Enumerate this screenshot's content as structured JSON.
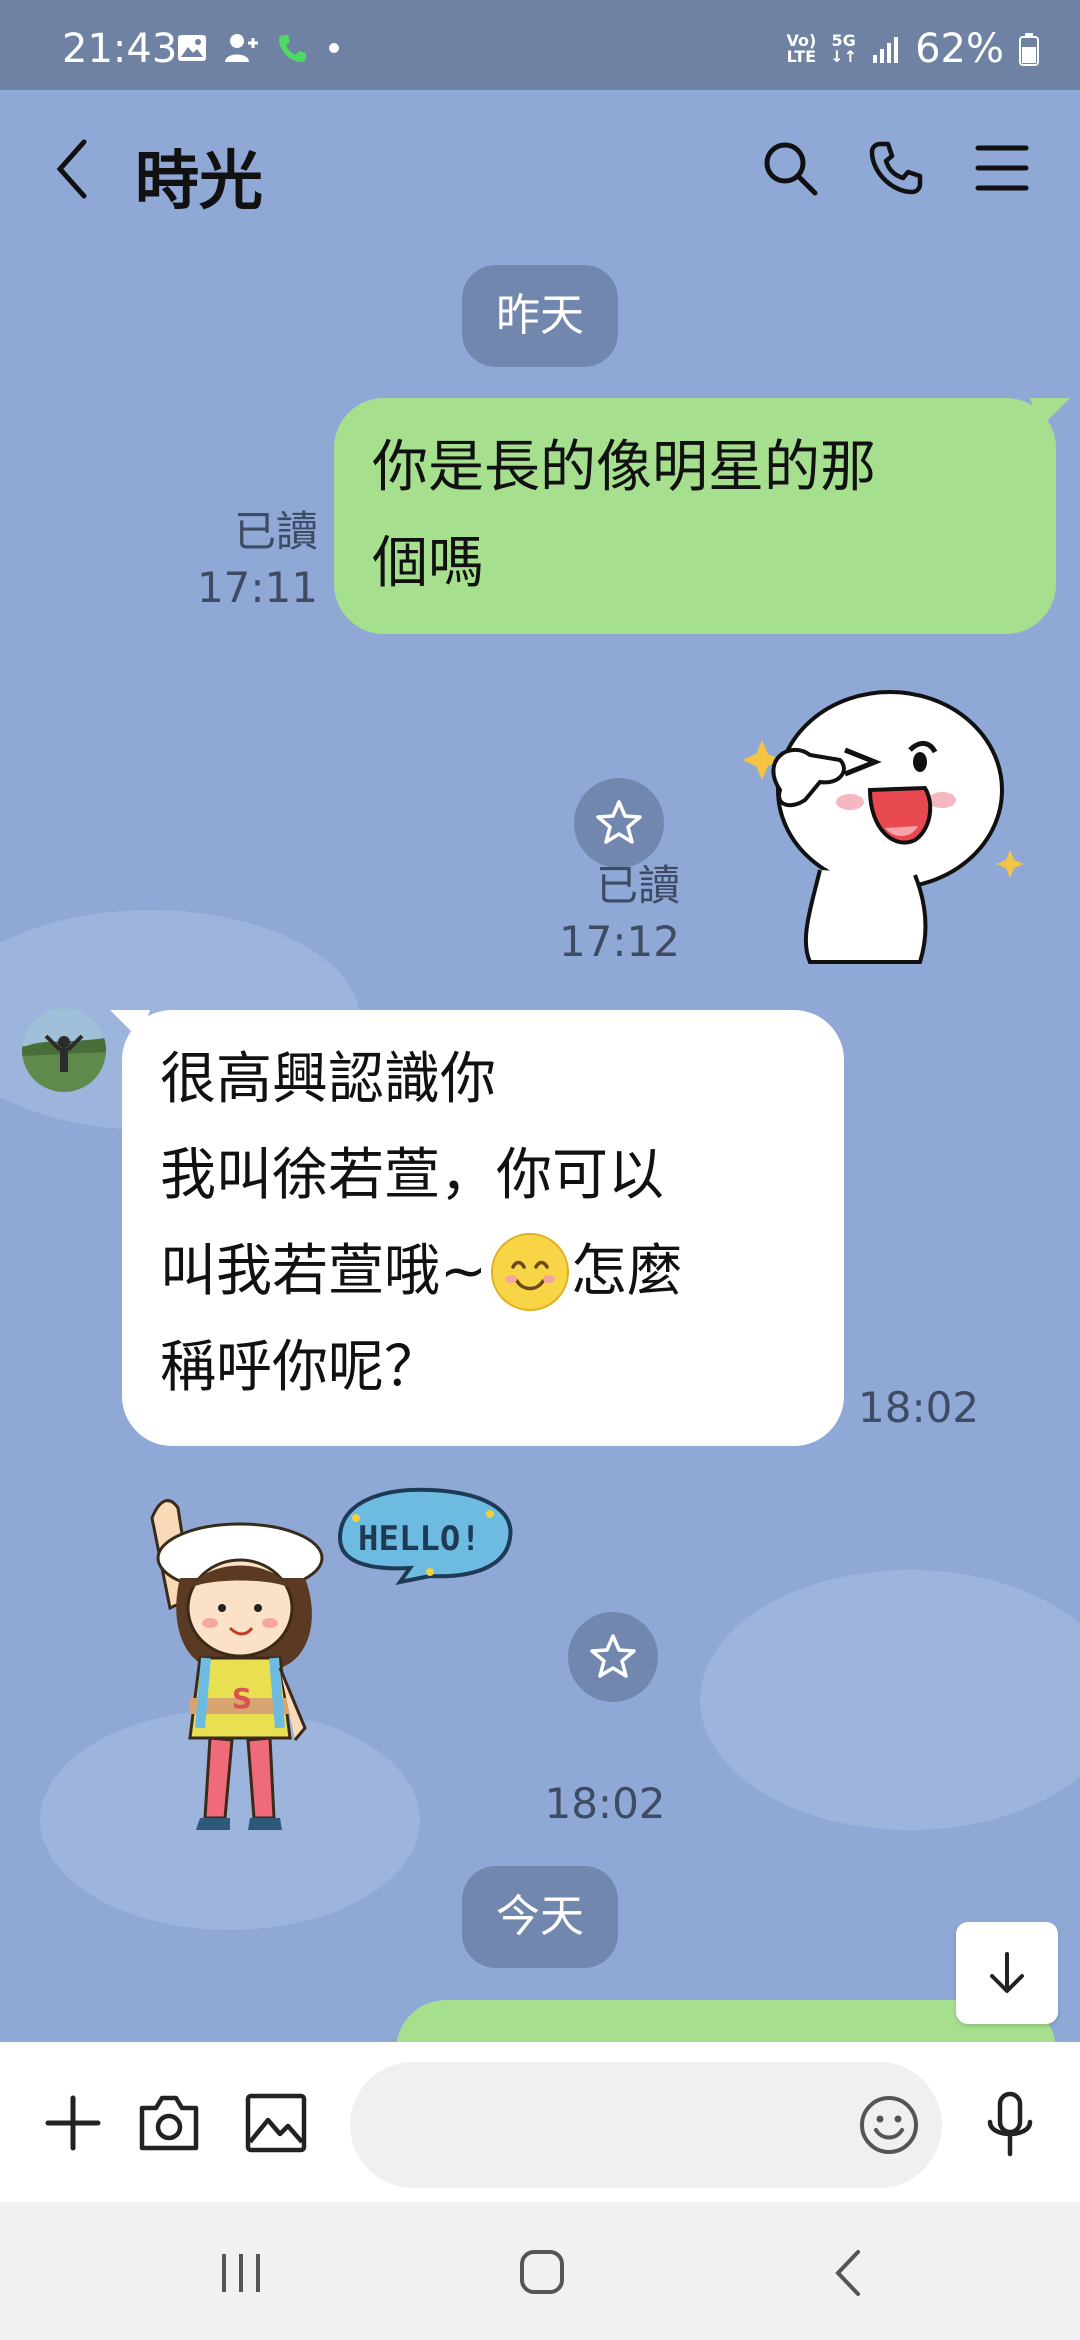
{
  "status_bar": {
    "time": "21:43",
    "volte_line1": "Vo)",
    "volte_line2": "LTE",
    "net_line1": "5G",
    "net_line2": "↓↑",
    "battery": "62%"
  },
  "header": {
    "title": "時光",
    "icons": [
      "back-icon",
      "search-icon",
      "phone-icon",
      "menu-icon"
    ]
  },
  "messages": {
    "date_yesterday": "昨天",
    "out1": {
      "line1": "你是長的像明星的那",
      "line2": "個嗎",
      "read": "已讀",
      "time": "17:11"
    },
    "sticker1": {
      "read": "已讀",
      "time": "17:12"
    },
    "in1": {
      "line1": "很高興認識你",
      "line2": "我叫徐若萱，你可以",
      "line3a": "叫我若萱哦~",
      "line3b": " 怎麼",
      "line4": "稱呼你呢？",
      "time": "18:02"
    },
    "sticker2": {
      "bubble_text": "HELLO!",
      "shirt_letter": "S",
      "time": "18:02"
    },
    "date_today": "今天"
  },
  "input_bar": {
    "placeholder": "",
    "icons": [
      "plus-icon",
      "camera-icon",
      "image-icon",
      "emoji-icon",
      "mic-icon"
    ]
  },
  "colors": {
    "chat_bg": "#8fa8d6",
    "outgoing_bubble": "#a6e08f",
    "incoming_bubble": "#ffffff",
    "date_pill": "#7287ae"
  }
}
